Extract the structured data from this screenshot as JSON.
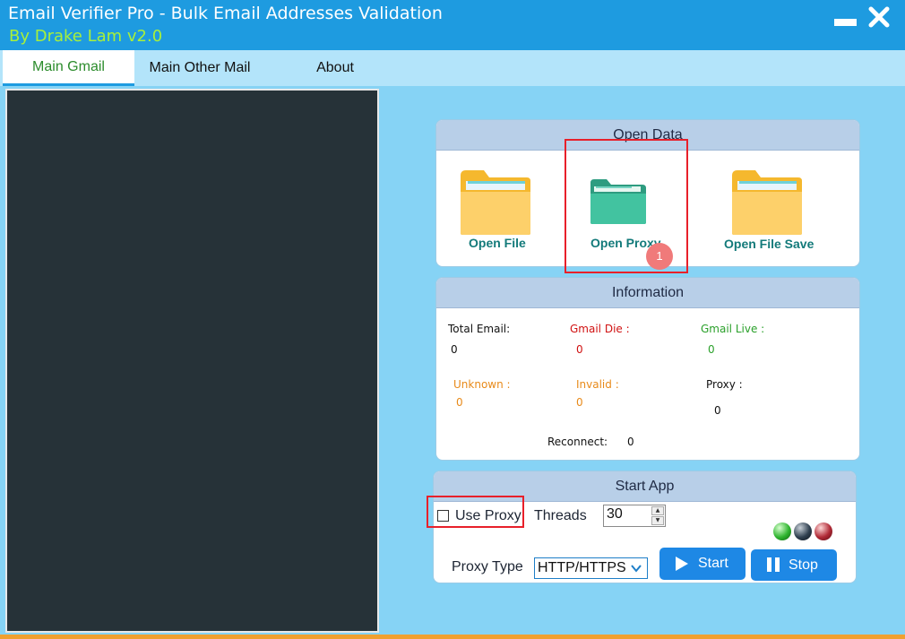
{
  "window": {
    "title": "Email Verifier Pro - Bulk Email Addresses Validation",
    "subtitle": "By Drake Lam  v2.0"
  },
  "tabs": [
    {
      "label": "Main Gmail",
      "active": true
    },
    {
      "label": "Main Other Mail",
      "active": false
    },
    {
      "label": "About",
      "active": false
    }
  ],
  "open_data": {
    "title": "Open Data",
    "open_file": "Open File",
    "open_proxy": "Open Proxy",
    "open_file_save": "Open File Save"
  },
  "information": {
    "title": "Information",
    "total_email_label": "Total Email:",
    "total_email_value": "0",
    "gmail_die_label": "Gmail Die :",
    "gmail_die_value": "0",
    "gmail_live_label": "Gmail  Live :",
    "gmail_live_value": "0",
    "unknown_label": "Unknown :",
    "unknown_value": "0",
    "invalid_label": "Invalid :",
    "invalid_value": "0",
    "proxy_label": "Proxy :",
    "proxy_value": "0",
    "reconnect_label": "Reconnect:",
    "reconnect_value": "0"
  },
  "start_app": {
    "title": "Start App",
    "use_proxy_label": "Use Proxy",
    "use_proxy_checked": false,
    "threads_label": "Threads",
    "threads_value": "30",
    "proxy_type_label": "Proxy Type",
    "proxy_type_value": "HTTP/HTTPS",
    "start_label": "Start",
    "stop_label": "Stop",
    "status_lights": [
      "green",
      "black",
      "red"
    ]
  },
  "annotation": {
    "badge": "1"
  },
  "colors": {
    "title_bar": "#1e9be0",
    "background": "#86d3f5",
    "accent_button": "#1e88e5",
    "highlight_box": "#e8202a"
  }
}
